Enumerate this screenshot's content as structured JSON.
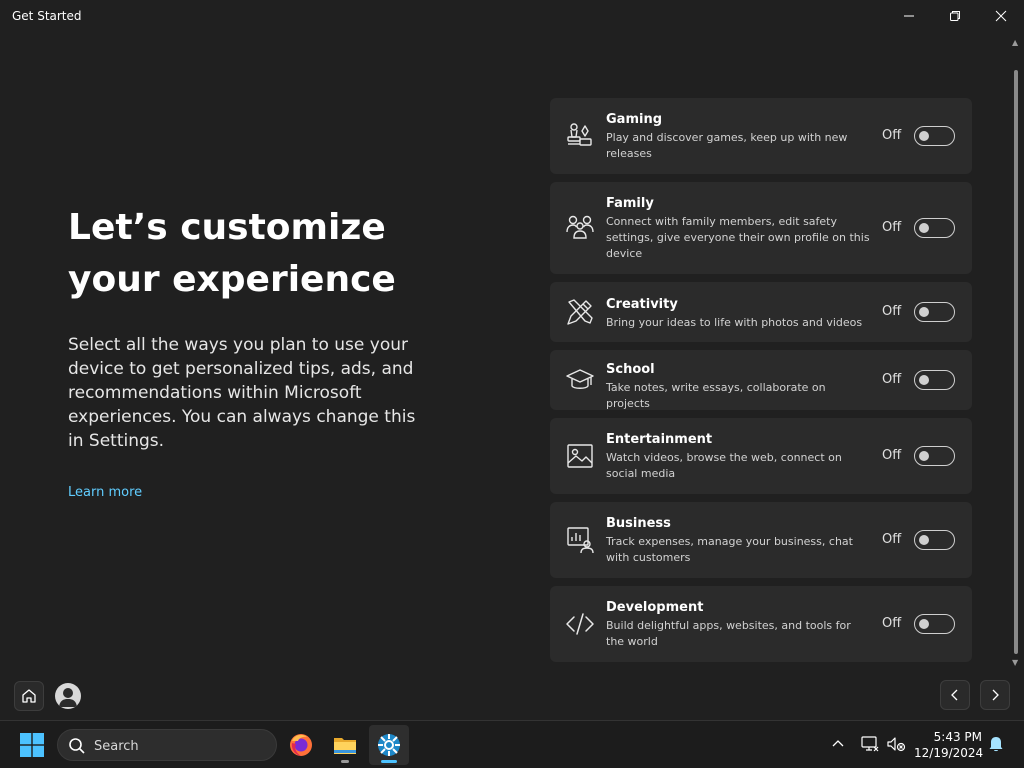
{
  "window": {
    "title": "Get Started"
  },
  "hero": {
    "title": "Let’s customize your experience",
    "description": "Select all the ways you plan to use your device to get personalized tips, ads, and recommendations within Microsoft experiences. You can always change this in Settings.",
    "learn_more": "Learn more"
  },
  "categories": [
    {
      "title": "Gaming",
      "description": "Play and discover games, keep up with new releases",
      "state": "Off",
      "icon": "gaming-icon",
      "enabled": false
    },
    {
      "title": "Family",
      "description": "Connect with family members, edit safety settings, give everyone their own profile on this device",
      "state": "Off",
      "icon": "family-icon",
      "enabled": false
    },
    {
      "title": "Creativity",
      "description": "Bring your ideas to life with photos and videos",
      "state": "Off",
      "icon": "creativity-icon",
      "enabled": false
    },
    {
      "title": "School",
      "description": "Take notes, write essays, collaborate on projects",
      "state": "Off",
      "icon": "school-icon",
      "enabled": false
    },
    {
      "title": "Entertainment",
      "description": "Watch videos, browse the web, connect on social media",
      "state": "Off",
      "icon": "entertainment-icon",
      "enabled": false
    },
    {
      "title": "Business",
      "description": "Track expenses, manage your business, chat with customers",
      "state": "Off",
      "icon": "business-icon",
      "enabled": false
    },
    {
      "title": "Development",
      "description": "Build delightful apps, websites, and tools for the world",
      "state": "Off",
      "icon": "development-icon",
      "enabled": false
    }
  ],
  "taskbar": {
    "search_placeholder": "Search",
    "apps": [
      "firefox-icon",
      "file-explorer-icon",
      "get-started-icon"
    ],
    "time": "5:43 PM",
    "date": "12/19/2024"
  },
  "colors": {
    "background": "#202020",
    "card": "#2b2b2b",
    "accent_link": "#60cdff",
    "taskbar": "#1c1c1c"
  }
}
